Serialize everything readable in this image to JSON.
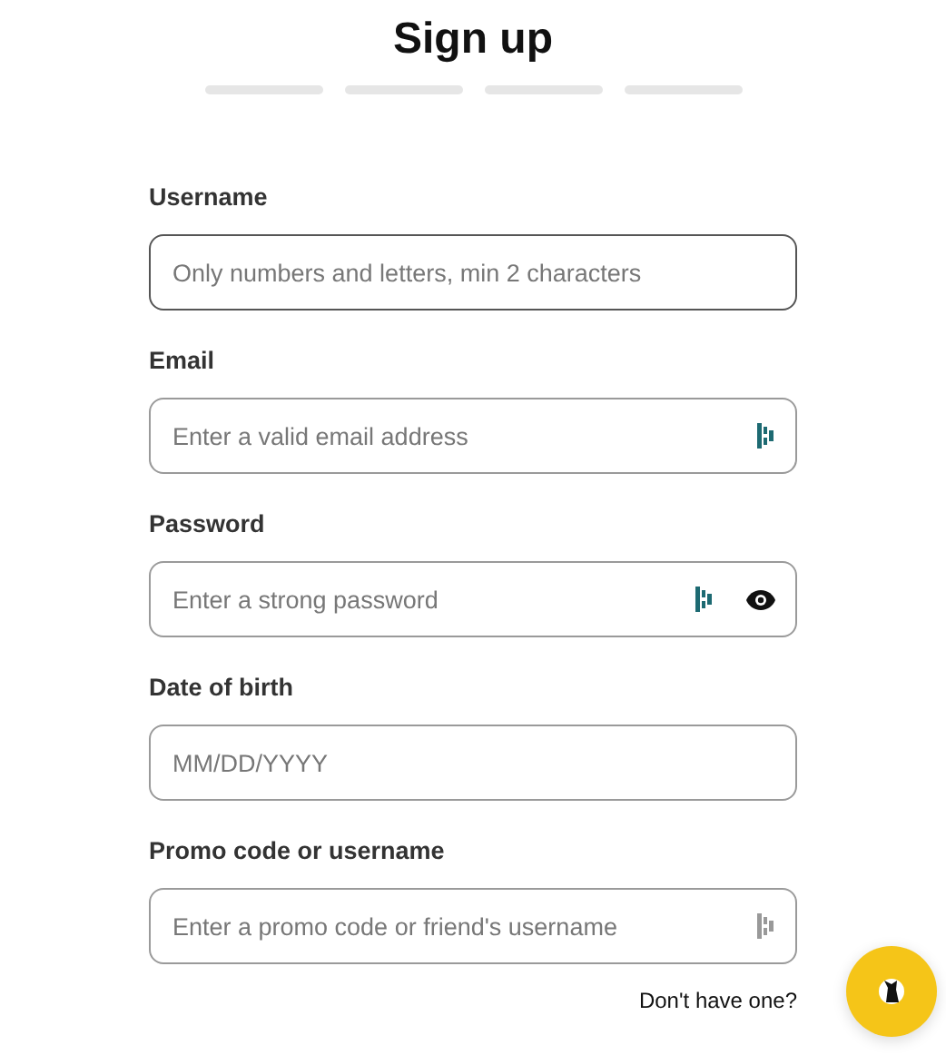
{
  "title": "Sign up",
  "progress_steps": [
    {
      "completed": false
    },
    {
      "completed": false
    },
    {
      "completed": false
    },
    {
      "completed": false
    }
  ],
  "fields": [
    {
      "kind": "text",
      "label": "Username",
      "placeholder": "Only numbers and letters, min 2 characters",
      "focused": true
    },
    {
      "kind": "email",
      "label": "Email",
      "placeholder": "Enter a valid email address",
      "focused": false
    },
    {
      "kind": "password",
      "label": "Password",
      "placeholder": "Enter a strong password",
      "focused": false
    },
    {
      "kind": "date",
      "label": "Date of birth",
      "placeholder": "MM/DD/YYYY",
      "focused": false
    },
    {
      "kind": "promo",
      "label": "Promo code or username",
      "placeholder": "Enter a promo code or friend's username",
      "focused": false
    }
  ],
  "promo_hint": "Don't have one?"
}
